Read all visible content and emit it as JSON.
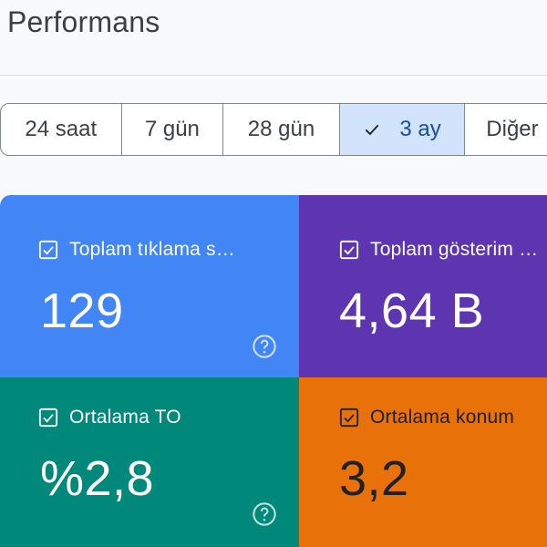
{
  "header": {
    "title": "Performans"
  },
  "date_range": {
    "options": [
      {
        "label": "24 saat",
        "selected": false
      },
      {
        "label": "7 gün",
        "selected": false
      },
      {
        "label": "28 gün",
        "selected": false
      },
      {
        "label": "3 ay",
        "selected": true
      },
      {
        "label": "Diğer",
        "selected": false
      }
    ]
  },
  "metrics": [
    {
      "label": "Toplam tıklama s…",
      "value": "129",
      "checked": true,
      "color": "#4285f4",
      "help_icon": "question-circle-icon"
    },
    {
      "label": "Toplam gösterim …",
      "value": "4,64 B",
      "checked": true,
      "color": "#5e35b1"
    },
    {
      "label": "Ortalama TO",
      "value": "%2,8",
      "checked": true,
      "color": "#00897b",
      "help_icon": "question-circle-icon"
    },
    {
      "label": "Ortalama konum",
      "value": "3,2",
      "checked": true,
      "color": "#e8710a"
    }
  ],
  "colors": {
    "selected_range_bg": "#d2e3fc",
    "divider": "#dadce0"
  }
}
